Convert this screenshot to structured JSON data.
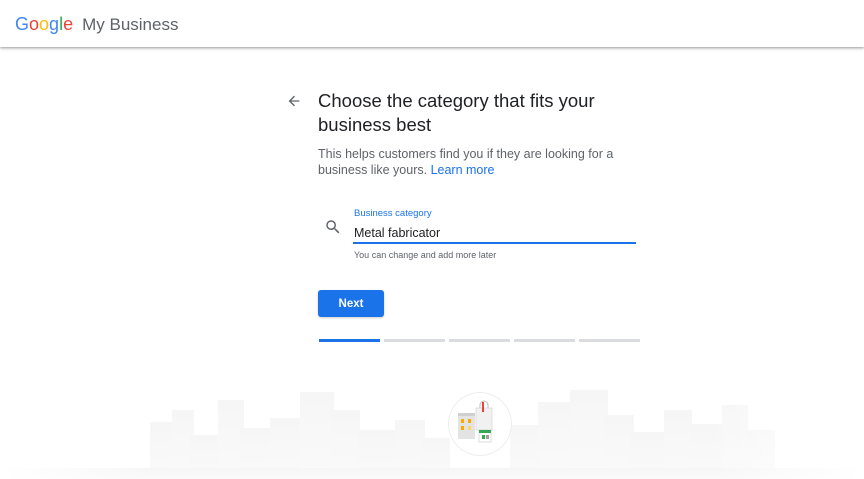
{
  "header": {
    "logo_letters": [
      {
        "char": "G",
        "color": "#4285F4"
      },
      {
        "char": "o",
        "color": "#EA4335"
      },
      {
        "char": "o",
        "color": "#FBBC05"
      },
      {
        "char": "g",
        "color": "#4285F4"
      },
      {
        "char": "l",
        "color": "#34A853"
      },
      {
        "char": "e",
        "color": "#EA4335"
      }
    ],
    "product_name": "My Business"
  },
  "main": {
    "title": "Choose the category that fits your business best",
    "subtitle": "This helps customers find you if they are looking for a business like yours.",
    "learn_more": "Learn more",
    "field": {
      "label": "Business category",
      "value": "Metal fabricator",
      "helper": "You can change and add more later"
    },
    "next_label": "Next",
    "progress": {
      "total_steps": 5,
      "current_step": 1
    }
  },
  "colors": {
    "accent": "#1a73e8",
    "text": "#202124",
    "muted": "#5f6368",
    "track": "#dadce0"
  },
  "icons": {
    "back": "arrow-left-icon",
    "search": "search-icon"
  }
}
